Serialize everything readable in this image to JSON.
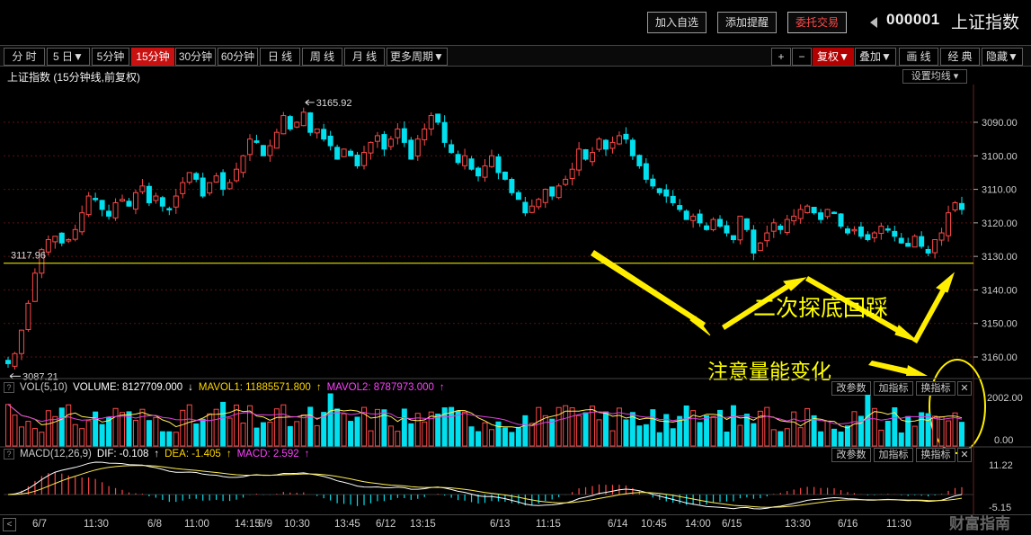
{
  "toolbar": {
    "add_watchlist": "加入自选",
    "add_alert": "添加提醒",
    "trade": "委托交易",
    "stock_code": "000001",
    "stock_name": "上证指数"
  },
  "periods": {
    "items": [
      "分 时",
      "5 日▼",
      "5分钟",
      "15分钟",
      "30分钟",
      "60分钟",
      "日 线",
      "周 线",
      "月 线",
      "更多周期▼"
    ],
    "active_index": 3,
    "right_items": [
      "+",
      "−",
      "复权▼",
      "叠加▼",
      "画 线",
      "经 典",
      "隐藏▼"
    ]
  },
  "main_chart": {
    "title": "上证指数 (15分钟线,前复权)",
    "set_ma": "设置均线 ▾",
    "price_labels": [
      "3160.00",
      "3150.00",
      "3140.00",
      "3130.00",
      "3120.00",
      "3110.00",
      "3100.00",
      "3090.00"
    ],
    "high_label": "3165.92",
    "low_label": "3087.21",
    "line_label": "3117.96",
    "annotation_main": "二次探底回踩",
    "annotation_volume": "注意量能变化",
    "colors": {
      "up": "#ff4848",
      "down": "#00e0ee",
      "line": "#ffff00"
    }
  },
  "volume_panel": {
    "name": "VOL(5,10)",
    "volume": "VOLUME: 8127709.000",
    "mavol1": "MAVOL1: 11885571.800",
    "mavol2": "MAVOL2: 8787973.000",
    "axis": [
      "2002.00",
      "0.00"
    ],
    "buttons": [
      "改参数",
      "加指标",
      "换指标",
      "✕"
    ]
  },
  "macd_panel": {
    "name": "MACD(12,26,9)",
    "dif": "DIF: -0.108",
    "dea": "DEA: -1.405",
    "macd": "MACD: 2.592",
    "axis": [
      "11.22",
      "-5.15"
    ],
    "buttons": [
      "改参数",
      "加指标",
      "换指标",
      "✕"
    ]
  },
  "xaxis": {
    "labels": [
      "6/7",
      "11:30",
      "6/8",
      "11:00",
      "14:15",
      "6/9",
      "10:30",
      "13:45",
      "6/12",
      "13:15",
      "6/13",
      "11:15",
      "6/14",
      "10:45",
      "14:00",
      "6/15",
      "13:30",
      "6/16",
      "11:30"
    ]
  },
  "watermark": "财富指南",
  "chart_data": {
    "type": "candlestick",
    "title": "上证指数 (15分钟线,前复权)",
    "ylim": [
      3083,
      3170
    ],
    "y_ticks": [
      3090,
      3100,
      3110,
      3120,
      3130,
      3140,
      3150,
      3160
    ],
    "support_level": 3117.96,
    "high": 3165.92,
    "low": 3087.21,
    "closes": [
      3088,
      3091,
      3098,
      3106,
      3115,
      3122,
      3125,
      3126,
      3124,
      3125,
      3128,
      3133,
      3138,
      3137,
      3134,
      3132,
      3136,
      3137,
      3135,
      3139,
      3141,
      3136,
      3138,
      3135,
      3134,
      3138,
      3142,
      3145,
      3143,
      3138,
      3142,
      3144,
      3140,
      3142,
      3146,
      3150,
      3155,
      3154,
      3150,
      3153,
      3157,
      3162,
      3158,
      3160,
      3163,
      3157,
      3158,
      3155,
      3153,
      3149,
      3152,
      3150,
      3147,
      3151,
      3154,
      3156,
      3152,
      3155,
      3158,
      3154,
      3149,
      3155,
      3158,
      3162,
      3160,
      3154,
      3151,
      3148,
      3150,
      3146,
      3144,
      3147,
      3150,
      3145,
      3143,
      3139,
      3137,
      3133,
      3135,
      3137,
      3140,
      3138,
      3141,
      3143,
      3146,
      3152,
      3149,
      3151,
      3155,
      3152,
      3154,
      3156,
      3155,
      3150,
      3147,
      3143,
      3141,
      3139,
      3138,
      3136,
      3134,
      3131,
      3132,
      3130,
      3128,
      3131,
      3129,
      3127,
      3125,
      3132,
      3128,
      3121,
      3124,
      3127,
      3130,
      3128,
      3131,
      3132,
      3134,
      3135,
      3133,
      3131,
      3134,
      3133,
      3129,
      3127,
      3128,
      3126,
      3125,
      3127,
      3129,
      3128,
      3126,
      3124,
      3123,
      3126,
      3123,
      3121,
      3125,
      3127,
      3133,
      3136,
      3134
    ],
    "mavol1": 11885571.8,
    "mavol2": 8787973.0,
    "volume_last": 8127709.0,
    "macd": {
      "dif": -0.108,
      "dea": -1.405,
      "macd": 2.592
    },
    "colors": {
      "up": "#ff4848",
      "down": "#00e0ee"
    }
  }
}
